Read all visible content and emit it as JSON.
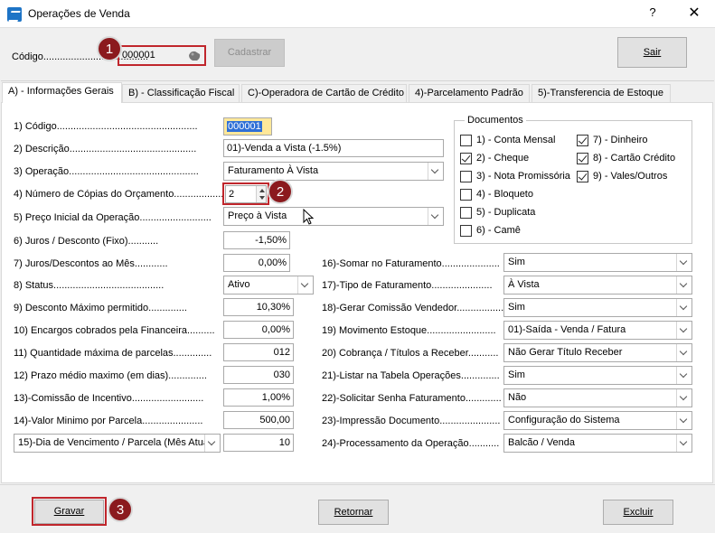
{
  "window": {
    "title": "Operações de Venda",
    "help": "?",
    "close": "✕"
  },
  "top": {
    "codigo_label": "Código......................................",
    "codigo_value": "000001",
    "cadastrar": "Cadastrar",
    "sair": "Sair"
  },
  "tabs": [
    {
      "label": "A) - Informações Gerais"
    },
    {
      "label": "B) - Classificação Fiscal"
    },
    {
      "label": "C)-Operadora de Cartão de Crédito"
    },
    {
      "label": "4)-Parcelamento Padrão"
    },
    {
      "label": "5)-Transferencia de Estoque"
    }
  ],
  "left": {
    "codigo": {
      "label": "1) Código...................................................",
      "value": "000001"
    },
    "descricao": {
      "label": "2) Descrição..............................................",
      "value": "01)-Venda a Vista (-1.5%)"
    },
    "operacao": {
      "label": "3) Operação...............................................",
      "value": "Faturamento À Vista"
    },
    "copias": {
      "label": "4) Número de Cópias do Orçamento..................",
      "value": "2"
    },
    "preco": {
      "label": "5) Preço Inicial da Operação..........................",
      "value": "Preço à Vista"
    },
    "juros": {
      "label": "6) Juros / Desconto (Fixo)...........",
      "value": "-1,50%"
    },
    "juros_mes": {
      "label": "7) Juros/Descontos ao Mês............",
      "value": "0,00%"
    },
    "status": {
      "label": "8) Status........................................",
      "value": "Ativo"
    },
    "desconto": {
      "label": "9) Desconto Máximo permitido..............",
      "value": "10,30%"
    },
    "encargos": {
      "label": "10) Encargos cobrados pela Financeira..........",
      "value": "0,00%"
    },
    "parcelas": {
      "label": "11) Quantidade máxima de parcelas..............",
      "value": "012"
    },
    "prazo": {
      "label": "12) Prazo médio maximo (em dias)..............",
      "value": "030"
    },
    "comissao": {
      "label": "13)-Comissão de Incentivo..........................",
      "value": "1,00%"
    },
    "valor_min": {
      "label": "14)-Valor Minimo por Parcela......................",
      "value": "500,00"
    },
    "dia_venc": {
      "label": "15)-Dia de Vencimento / Parcela (Mês Atual)",
      "value": "10"
    }
  },
  "documentos": {
    "title": "Documentos",
    "items": [
      {
        "label": "1) - Conta Mensal",
        "checked": false
      },
      {
        "label": "2) - Cheque",
        "checked": true
      },
      {
        "label": "3) - Nota Promissória",
        "checked": false
      },
      {
        "label": "4) - Bloqueto",
        "checked": false
      },
      {
        "label": "5) - Duplicata",
        "checked": false
      },
      {
        "label": "6) - Camê",
        "checked": false
      },
      {
        "label": "7) - Dinheiro",
        "checked": true
      },
      {
        "label": "8) - Cartão Crédito",
        "checked": true
      },
      {
        "label": "9) - Vales/Outros",
        "checked": true
      }
    ]
  },
  "right": {
    "somar": {
      "label": "16)-Somar no Faturamento.....................",
      "value": "Sim"
    },
    "tipo": {
      "label": "17)-Tipo de Faturamento......................",
      "value": "À Vista"
    },
    "gerar_comissao": {
      "label": "18)-Gerar Comissão Vendedor.................",
      "value": "Sim"
    },
    "movimento": {
      "label": "19) Movimento Estoque.........................",
      "value": "01)-Saída - Venda / Fatura"
    },
    "cobranca": {
      "label": "20) Cobrança / Títulos a Receber...........",
      "value": "Não Gerar Título Receber"
    },
    "listar": {
      "label": "21)-Listar na Tabela Operações..............",
      "value": "Sim"
    },
    "senha": {
      "label": "22)-Solicitar Senha Faturamento.............",
      "value": "Não"
    },
    "impressao": {
      "label": "23)-Impressão Documento......................",
      "value": "Configuração do Sistema"
    },
    "processamento": {
      "label": "24)-Processamento da Operação...........",
      "value": "Balcão / Venda"
    }
  },
  "bottom": {
    "gravar": "Gravar",
    "retornar": "Retornar",
    "excluir": "Excluir"
  },
  "badges": [
    "1",
    "2",
    "3"
  ]
}
